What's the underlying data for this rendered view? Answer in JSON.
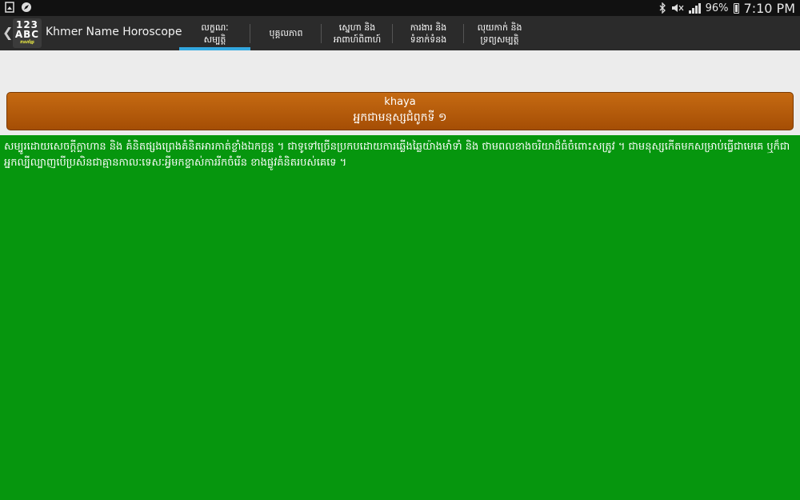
{
  "status_bar": {
    "left_icons": [
      "gallery-icon",
      "compass-icon"
    ],
    "battery_percent": "96%",
    "time": "7:10 PM"
  },
  "action_bar": {
    "logo": {
      "line1": "123",
      "line2": "ABC",
      "line3": "ភាសាខ្មែរ"
    },
    "title": "Khmer Name Horoscope",
    "tabs": [
      {
        "label": "លក្ខណៈ\nសម្បត្តិ",
        "active": true
      },
      {
        "label": "បុគ្គលភាព",
        "active": false
      },
      {
        "label": "ស្នេហា និង\nអាពាហ៍ពិពាហ៍",
        "active": false
      },
      {
        "label": "ការងារ និង\nទំនាក់ទំនង",
        "active": false
      },
      {
        "label": "លុយកាក់ និង\nទ្រព្យសម្បត្តិ",
        "active": false
      }
    ]
  },
  "card": {
    "name": "khaya",
    "subtitle": "អ្នកជាមនុស្សជំពូកទី ១"
  },
  "description": "សម្បូរដោយសេចក្ដីក្លាហាន និង គំនិតផ្សងព្រេងគំនិតអារកាត់ខ្លាំងឯកច្ឆន្ទ ។ ជាទូទៅច្រើនប្រកបដោយការឆ្លើងឆ្លៃយ៉ាងមាំទាំ និង ថាមពលខាងចរិយាដ៏ធំចំពោះសត្រូវ ។ ជាមនុស្សកើតមកសម្រាប់ធ្វើជាមេគេ ឬក៏ជាអ្នកល្បីល្បាញបើប្រសិនជាគ្មានកាលៈទេសៈអ្វីមកខ្ទាស់ការរីកចំរើន ខាងផ្លូវគំនិតរបស់គេទេ ។",
  "colors": {
    "status_bar": "#111111",
    "action_bar": "#2b2b2b",
    "tab_indicator": "#33a8e0",
    "card": "#b45c0a",
    "panel": "#06960e",
    "background": "#ececec"
  }
}
